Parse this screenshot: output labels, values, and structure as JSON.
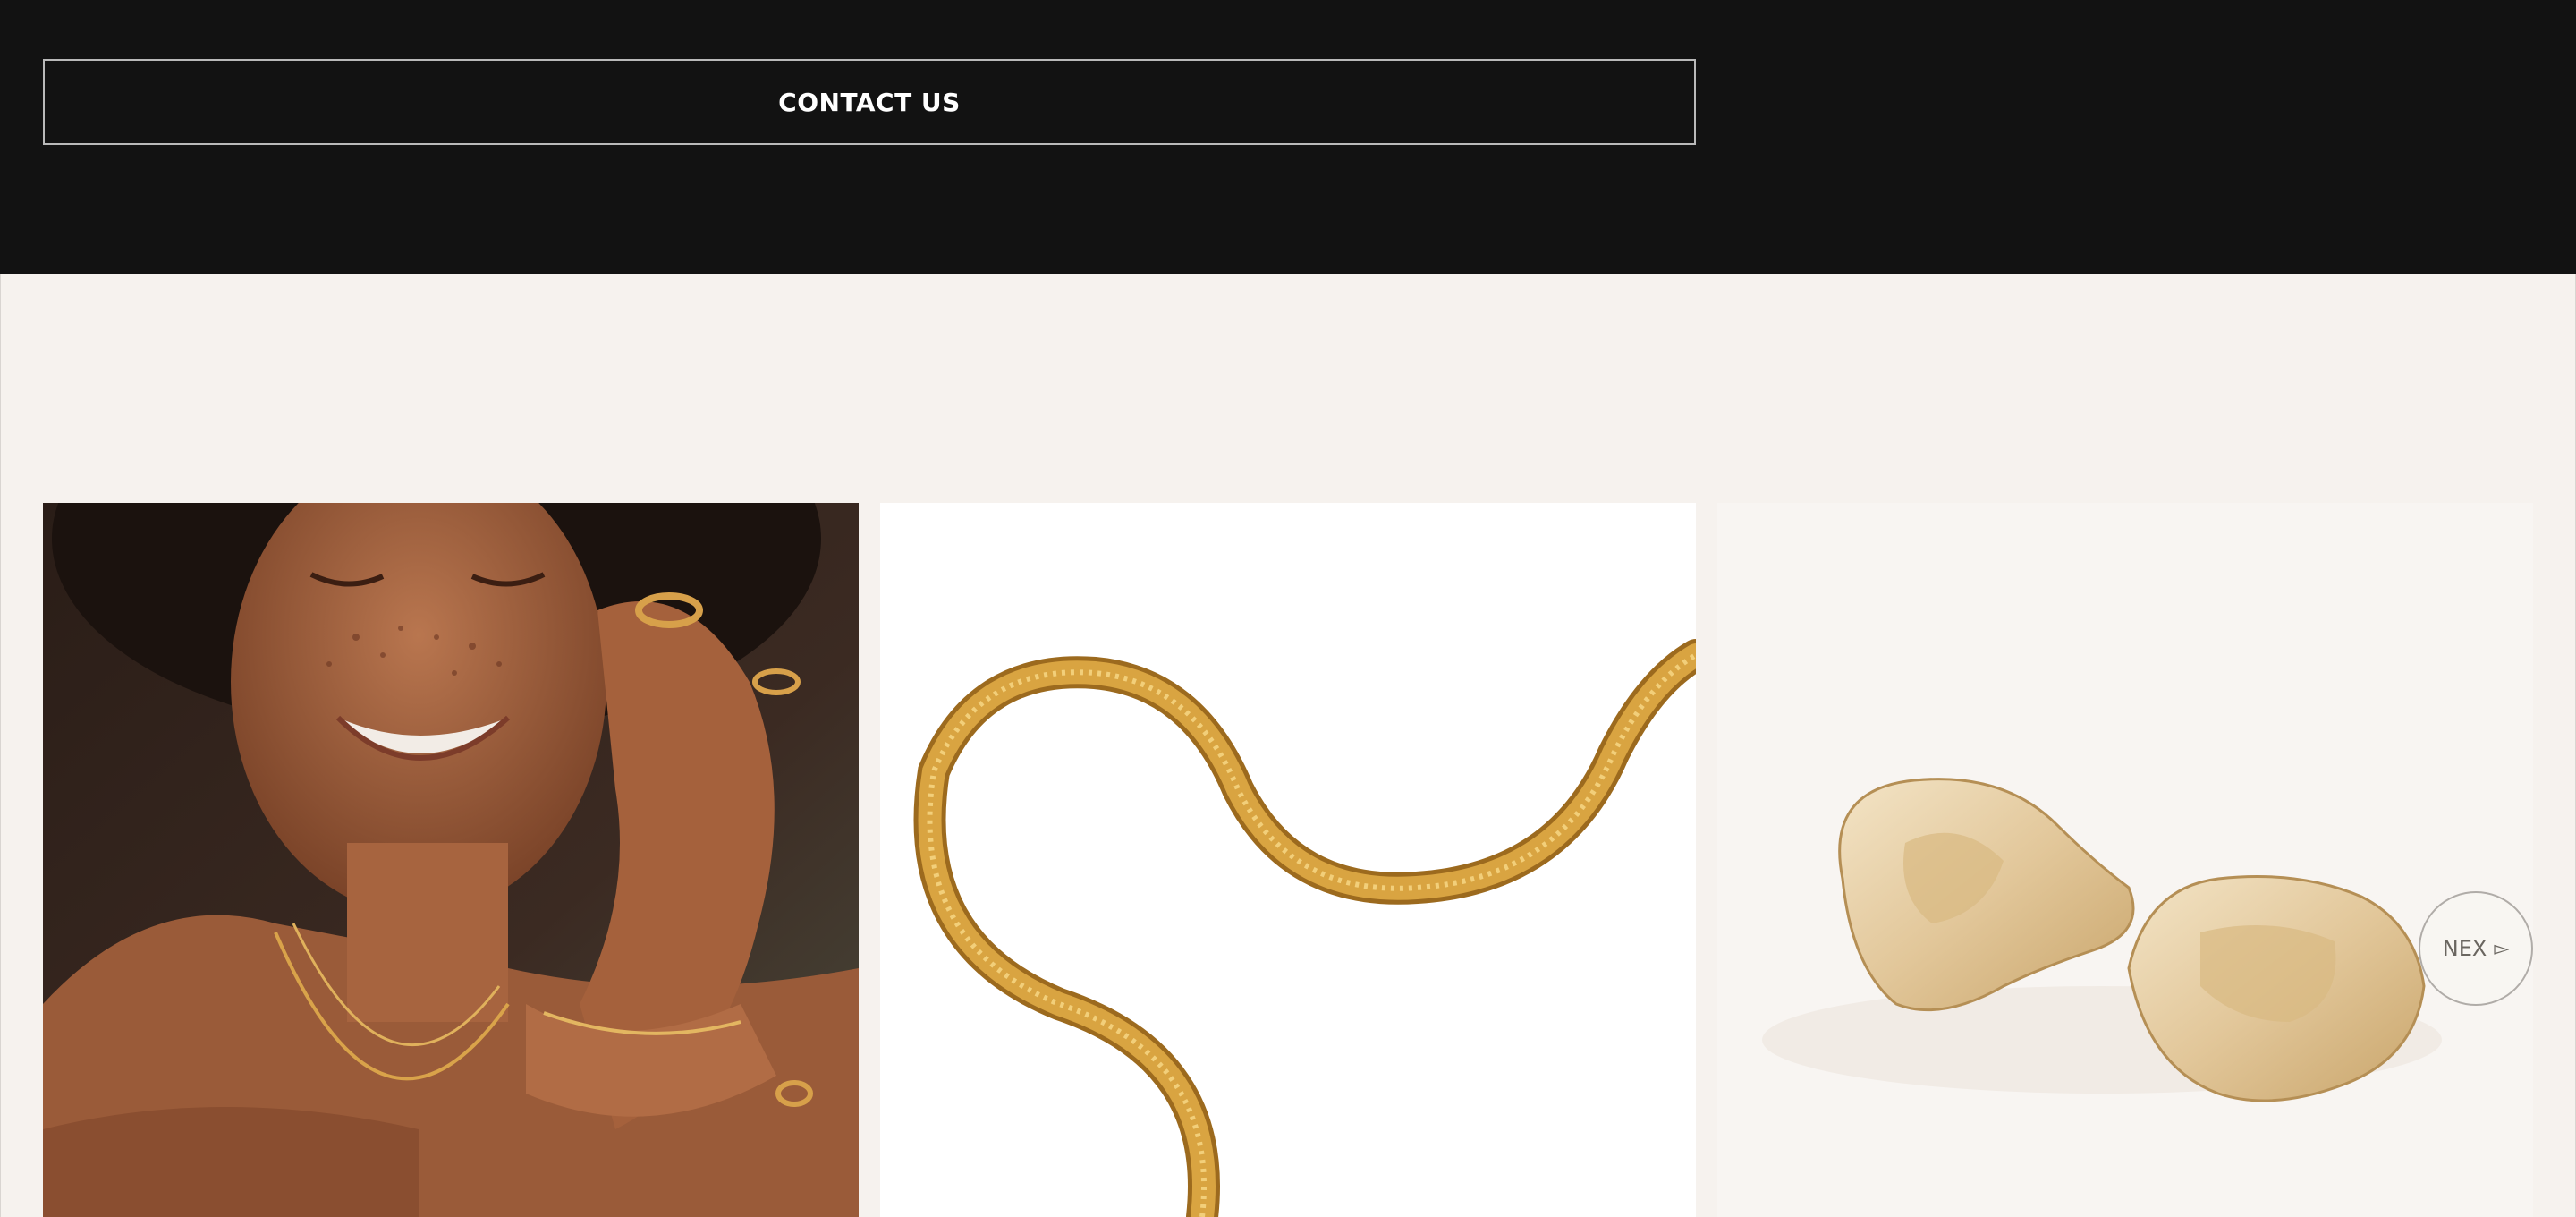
{
  "contact": {
    "label": "CONTACT US"
  },
  "gallery": {
    "tiles": [
      {
        "icon": "model-wearing-gold-jewelry-photo"
      },
      {
        "icon": "gold-snake-chain-photo"
      },
      {
        "icon": "gold-sculptural-hoop-earrings-photo"
      }
    ],
    "next_label": "NEX",
    "next_icon": "triangle-right-icon"
  },
  "colors": {
    "dark_band": "#121212",
    "light_background": "#f6f2ee",
    "gold": "#c9922e"
  }
}
